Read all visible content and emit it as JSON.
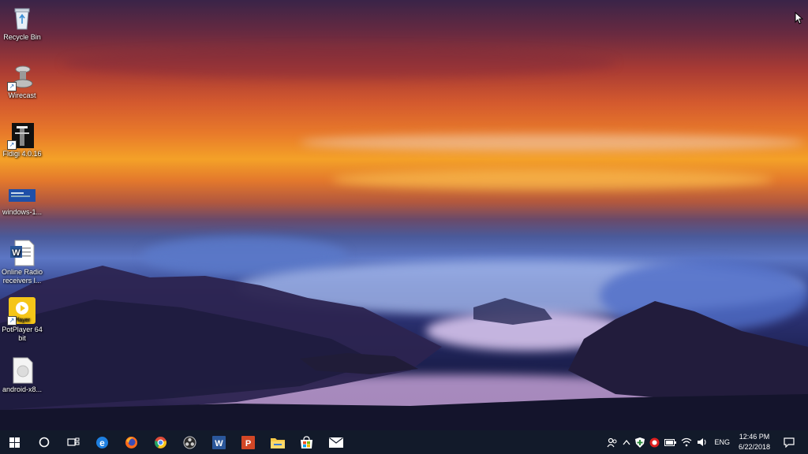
{
  "desktop": {
    "icons": [
      {
        "label": "Recycle Bin",
        "icon": "recycle-bin-icon"
      },
      {
        "label": "Wirecast",
        "icon": "wirecast-icon"
      },
      {
        "label": "Fldigi 4.0.16",
        "icon": "fldigi-icon"
      },
      {
        "label": "windows-1...",
        "icon": "windows-shortcut-icon"
      },
      {
        "label": "Online Radio receivers l...",
        "icon": "word-document-icon"
      },
      {
        "label": "PotPlayer 64 bit",
        "icon": "potplayer-icon"
      },
      {
        "label": "android-x8...",
        "icon": "android-file-icon"
      }
    ],
    "potplayer_badge": "Player"
  },
  "taskbar": {
    "pinned": [
      "start-icon",
      "cortana-icon",
      "task-view-icon",
      "edge-icon",
      "firefox-icon",
      "chrome-icon",
      "obs-icon",
      "word-icon",
      "powerpoint-icon",
      "file-explorer-icon",
      "store-icon",
      "mail-icon"
    ],
    "tray": {
      "language": "ENG",
      "time": "12:46 PM",
      "date": "6/22/2018"
    }
  },
  "colors": {
    "taskbar": "#121a2a",
    "accent": "#0078d7"
  }
}
